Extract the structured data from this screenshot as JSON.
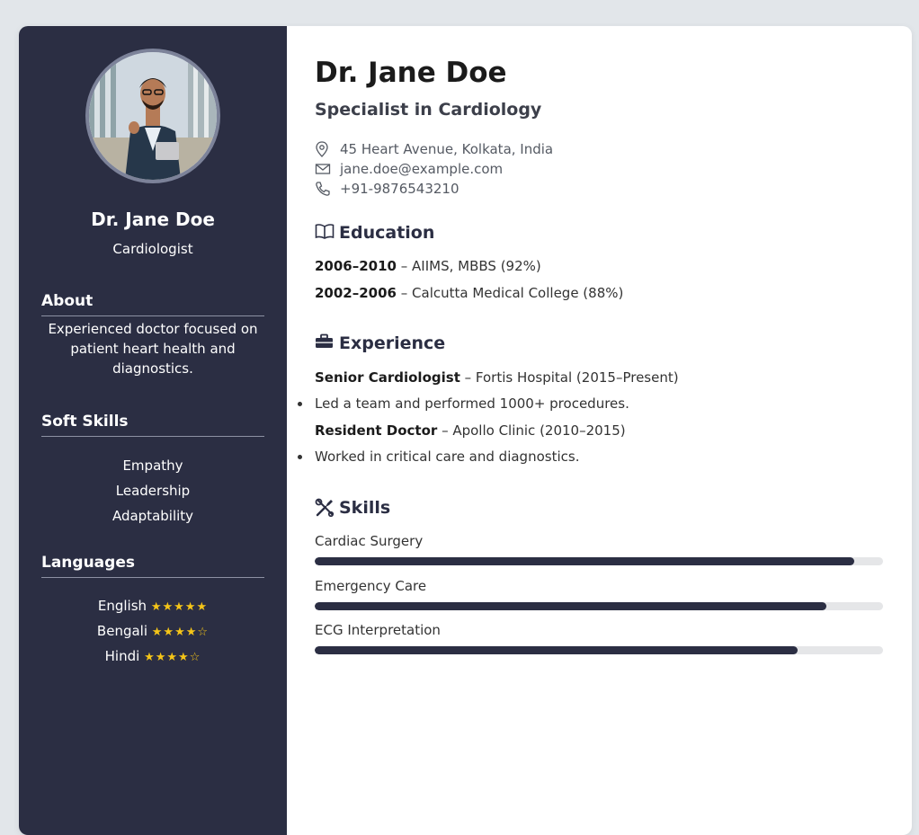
{
  "sidebar": {
    "avatar_alt": "profile-photo",
    "name": "Dr. Jane Doe",
    "title": "Cardiologist",
    "about": {
      "heading": "About",
      "text": "Experienced doctor focused on patient heart health and diagnostics."
    },
    "soft_skills": {
      "heading": "Soft Skills",
      "items": [
        "Empathy",
        "Leadership",
        "Adaptability"
      ]
    },
    "languages": {
      "heading": "Languages",
      "items": [
        {
          "name": "English",
          "stars": "★★★★★",
          "rating": 5
        },
        {
          "name": "Bengali",
          "stars": "★★★★☆",
          "rating": 4
        },
        {
          "name": "Hindi",
          "stars": "★★★★☆",
          "rating": 4
        }
      ]
    }
  },
  "main": {
    "name": "Dr. Jane Doe",
    "subtitle": "Specialist in Cardiology",
    "contact": {
      "address": "45 Heart Avenue, Kolkata, India",
      "email": "jane.doe@example.com",
      "phone": "+91-9876543210"
    },
    "education": {
      "heading": "Education",
      "items": [
        {
          "years": "2006–2010",
          "detail": " – AIIMS, MBBS (92%)"
        },
        {
          "years": "2002–2006",
          "detail": " – Calcutta Medical College (88%)"
        }
      ]
    },
    "experience": {
      "heading": "Experience",
      "items": [
        {
          "role": "Senior Cardiologist",
          "detail": " – Fortis Hospital (2015–Present)",
          "bullet": "Led a team and performed 1000+ procedures."
        },
        {
          "role": "Resident Doctor",
          "detail": " – Apollo Clinic (2010–2015)",
          "bullet": "Worked in critical care and diagnostics."
        }
      ]
    },
    "skills": {
      "heading": "Skills",
      "items": [
        {
          "name": "Cardiac Surgery",
          "level": 0.95
        },
        {
          "name": "Emergency Care",
          "level": 0.9
        },
        {
          "name": "ECG Interpretation",
          "level": 0.85
        }
      ]
    }
  },
  "colors": {
    "sidebar_bg": "#2b2e43",
    "accent": "#2b2e43",
    "star": "#f5c518",
    "page_bg": "#e2e6ea"
  },
  "icons": [
    "location-pin-icon",
    "envelope-icon",
    "phone-icon",
    "book-icon",
    "briefcase-icon",
    "tools-icon"
  ]
}
